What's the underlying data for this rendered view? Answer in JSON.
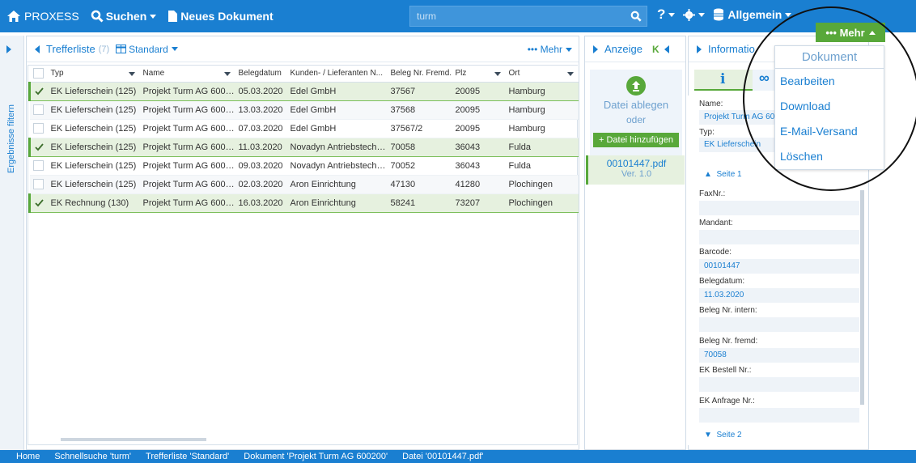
{
  "topbar": {
    "brand": "PROXESS",
    "search_btn": "Suchen",
    "new_doc": "Neues Dokument",
    "search_value": "turm",
    "profile": "Allgemein"
  },
  "leftstrip": {
    "filter_label": "Ergebnisse filtern"
  },
  "results": {
    "title": "Trefferliste",
    "count": "(7)",
    "view": "Standard",
    "more": "Mehr",
    "columns": [
      "Typ",
      "Name",
      "Belegdatum",
      "Kunden- / Lieferanten N...",
      "Beleg Nr. Fremd...",
      "Plz",
      "Ort"
    ],
    "rows": [
      {
        "checked": true,
        "typ": "EK Lieferschein (125)",
        "name": "Projekt Turm AG 600200",
        "datum": "05.03.2020",
        "kunde": "Edel GmbH",
        "beleg": "37567",
        "plz": "20095",
        "ort": "Hamburg"
      },
      {
        "checked": false,
        "typ": "EK Lieferschein (125)",
        "name": "Projekt Turm AG 600200",
        "datum": "13.03.2020",
        "kunde": "Edel GmbH",
        "beleg": "37568",
        "plz": "20095",
        "ort": "Hamburg"
      },
      {
        "checked": false,
        "typ": "EK Lieferschein (125)",
        "name": "Projekt Turm AG 600200",
        "datum": "07.03.2020",
        "kunde": "Edel GmbH",
        "beleg": "37567/2",
        "plz": "20095",
        "ort": "Hamburg"
      },
      {
        "checked": true,
        "typ": "EK Lieferschein (125)",
        "name": "Projekt Turm AG 600200",
        "datum": "11.03.2020",
        "kunde": "Novadyn Antriebstechnik...",
        "beleg": "70058",
        "plz": "36043",
        "ort": "Fulda"
      },
      {
        "checked": false,
        "typ": "EK Lieferschein (125)",
        "name": "Projekt Turm AG 600200",
        "datum": "09.03.2020",
        "kunde": "Novadyn Antriebstechnik...",
        "beleg": "70052",
        "plz": "36043",
        "ort": "Fulda"
      },
      {
        "checked": false,
        "typ": "EK Lieferschein (125)",
        "name": "Projekt Turm AG 600200",
        "datum": "02.03.2020",
        "kunde": "Aron Einrichtung",
        "beleg": "47130",
        "plz": "41280",
        "ort": "Plochingen"
      },
      {
        "checked": true,
        "typ": "EK Rechnung (130)",
        "name": "Projekt Turm AG 600200",
        "datum": "16.03.2020",
        "kunde": "Aron Einrichtung",
        "beleg": "58241",
        "plz": "73207",
        "ort": "Plochingen"
      }
    ]
  },
  "viewer": {
    "title": "Anzeige",
    "drop_text": "Datei ablegen",
    "or_text": "oder",
    "add_btn": "+ Datei hinzufügen",
    "file_name": "00101447.pdf",
    "file_version": "Ver. 1.0"
  },
  "info": {
    "title": "Informatio",
    "name_label": "Name:",
    "name_value": "Projekt Turm AG 600200",
    "typ_label": "Typ:",
    "typ_value": "EK Lieferschein",
    "page1": "Seite 1",
    "fax_label": "FaxNr.:",
    "mandant_label": "Mandant:",
    "barcode_label": "Barcode:",
    "barcode_value": "00101447",
    "belegdatum_label": "Belegdatum:",
    "belegdatum_value": "11.03.2020",
    "beleg_intern_label": "Beleg Nr. intern:",
    "beleg_fremd_label": "Beleg Nr. fremd:",
    "beleg_fremd_value": "70058",
    "bestell_label": "EK Bestell Nr.:",
    "anfrage_label": "EK Anfrage Nr.:",
    "page2": "Seite 2"
  },
  "menu": {
    "button": "Mehr",
    "header": "Dokument",
    "items": [
      "Bearbeiten",
      "Download",
      "E-Mail-Versand",
      "Löschen"
    ]
  },
  "breadcrumb": [
    "Home",
    "Schnellsuche 'turm'",
    "Trefferliste 'Standard'",
    "Dokument 'Projekt Turm AG 600200'",
    "Datei '00101447.pdf'"
  ],
  "colors": {
    "primary": "#1a7fd1",
    "accent": "#58a83a"
  }
}
